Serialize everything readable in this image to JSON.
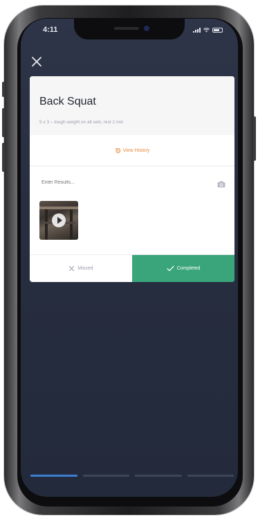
{
  "status": {
    "time": "4:11"
  },
  "workout": {
    "title": "Back Squat",
    "description": "5 x 3 – tough weight on all sets; rest 2 min",
    "history_label": "View History",
    "results_placeholder": "Enter Results...",
    "missed_label": "Missed",
    "completed_label": "Completed"
  },
  "progress": {
    "total_segments": 4,
    "active_segment": 1
  },
  "icons": {
    "close": "close-icon",
    "history": "history-icon",
    "camera": "camera-icon",
    "play": "play-icon",
    "missed": "x-icon",
    "completed": "check-icon"
  },
  "colors": {
    "background": "#272e40",
    "accent_orange": "#e88a3a",
    "completed_green": "#3aa57a",
    "progress_active": "#3b7fd0"
  }
}
